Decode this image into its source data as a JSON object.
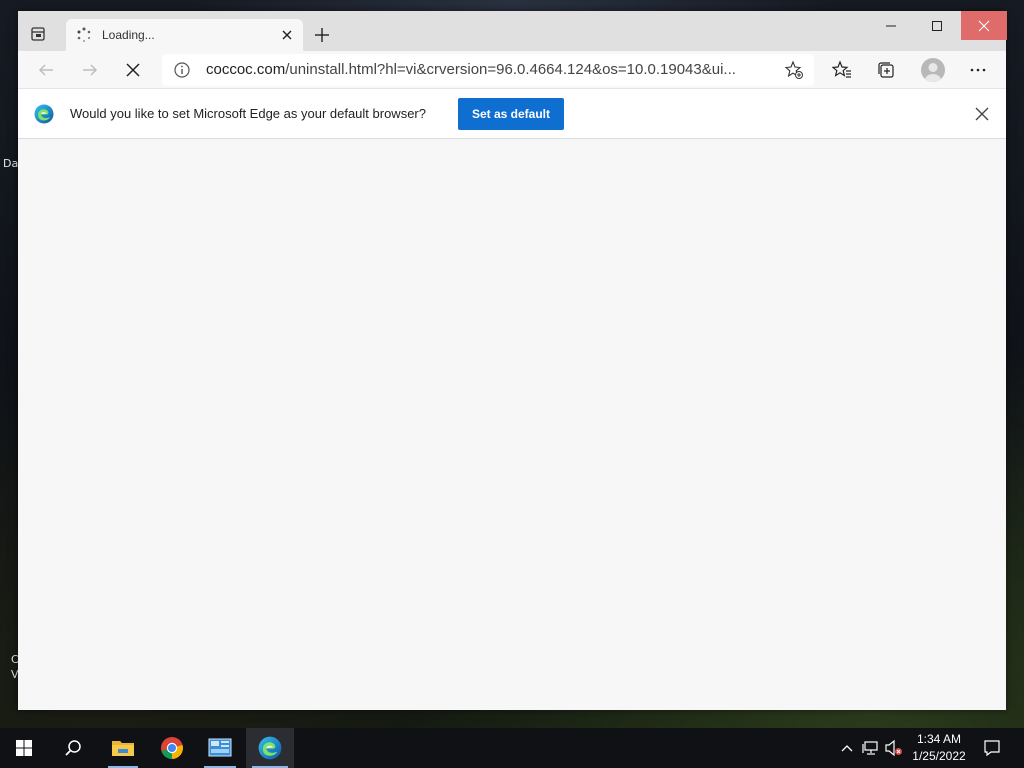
{
  "browser": {
    "tab_title": "Loading...",
    "url_domain": "coccoc.com",
    "url_path": "/uninstall.html?hl=vi&crversion=96.0.4664.124&os=10.0.19043&ui..."
  },
  "infobar": {
    "message": "Would you like to set Microsoft Edge as your default browser?",
    "button_label": "Set as default"
  },
  "desktop": {
    "fragment_1": "Da",
    "fragment_2": "C",
    "fragment_3": "V"
  },
  "taskbar": {
    "apps": [
      "file-explorer",
      "chrome",
      "control-panel",
      "edge"
    ],
    "time": "1:34 AM",
    "date": "1/25/2022"
  },
  "colors": {
    "accent": "#0f6fd1",
    "close_button": "#e06b6b"
  }
}
